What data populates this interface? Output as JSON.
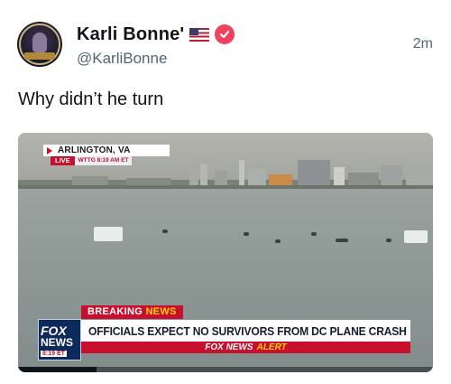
{
  "author": {
    "display_name": "Karli Bonne'",
    "handle": "@KarliBonne",
    "flag_icon": "us-flag-icon",
    "verified_icon": "verified-badge-icon",
    "verified_color": "#f2415e"
  },
  "post": {
    "timestamp": "2m",
    "text": "Why didn’t he turn"
  },
  "video": {
    "location": "ARLINGTON, VA",
    "live_label": "LIVE",
    "live_info": "WTTG  8:19 AM ET",
    "breaking_label": "BREAKING",
    "breaking_news_label": "NEWS",
    "headline": "OFFICIALS EXPECT NO SURVIVORS FROM DC PLANE CRASH",
    "alert_brand": "FOX NEWS",
    "alert_word": "ALERT",
    "logo_fox": "FOX",
    "logo_news": "NEWS",
    "logo_time": "8:19 ET",
    "progress": 0.19,
    "accent_red": "#c8102e",
    "accent_yellow": "#ffd200"
  }
}
